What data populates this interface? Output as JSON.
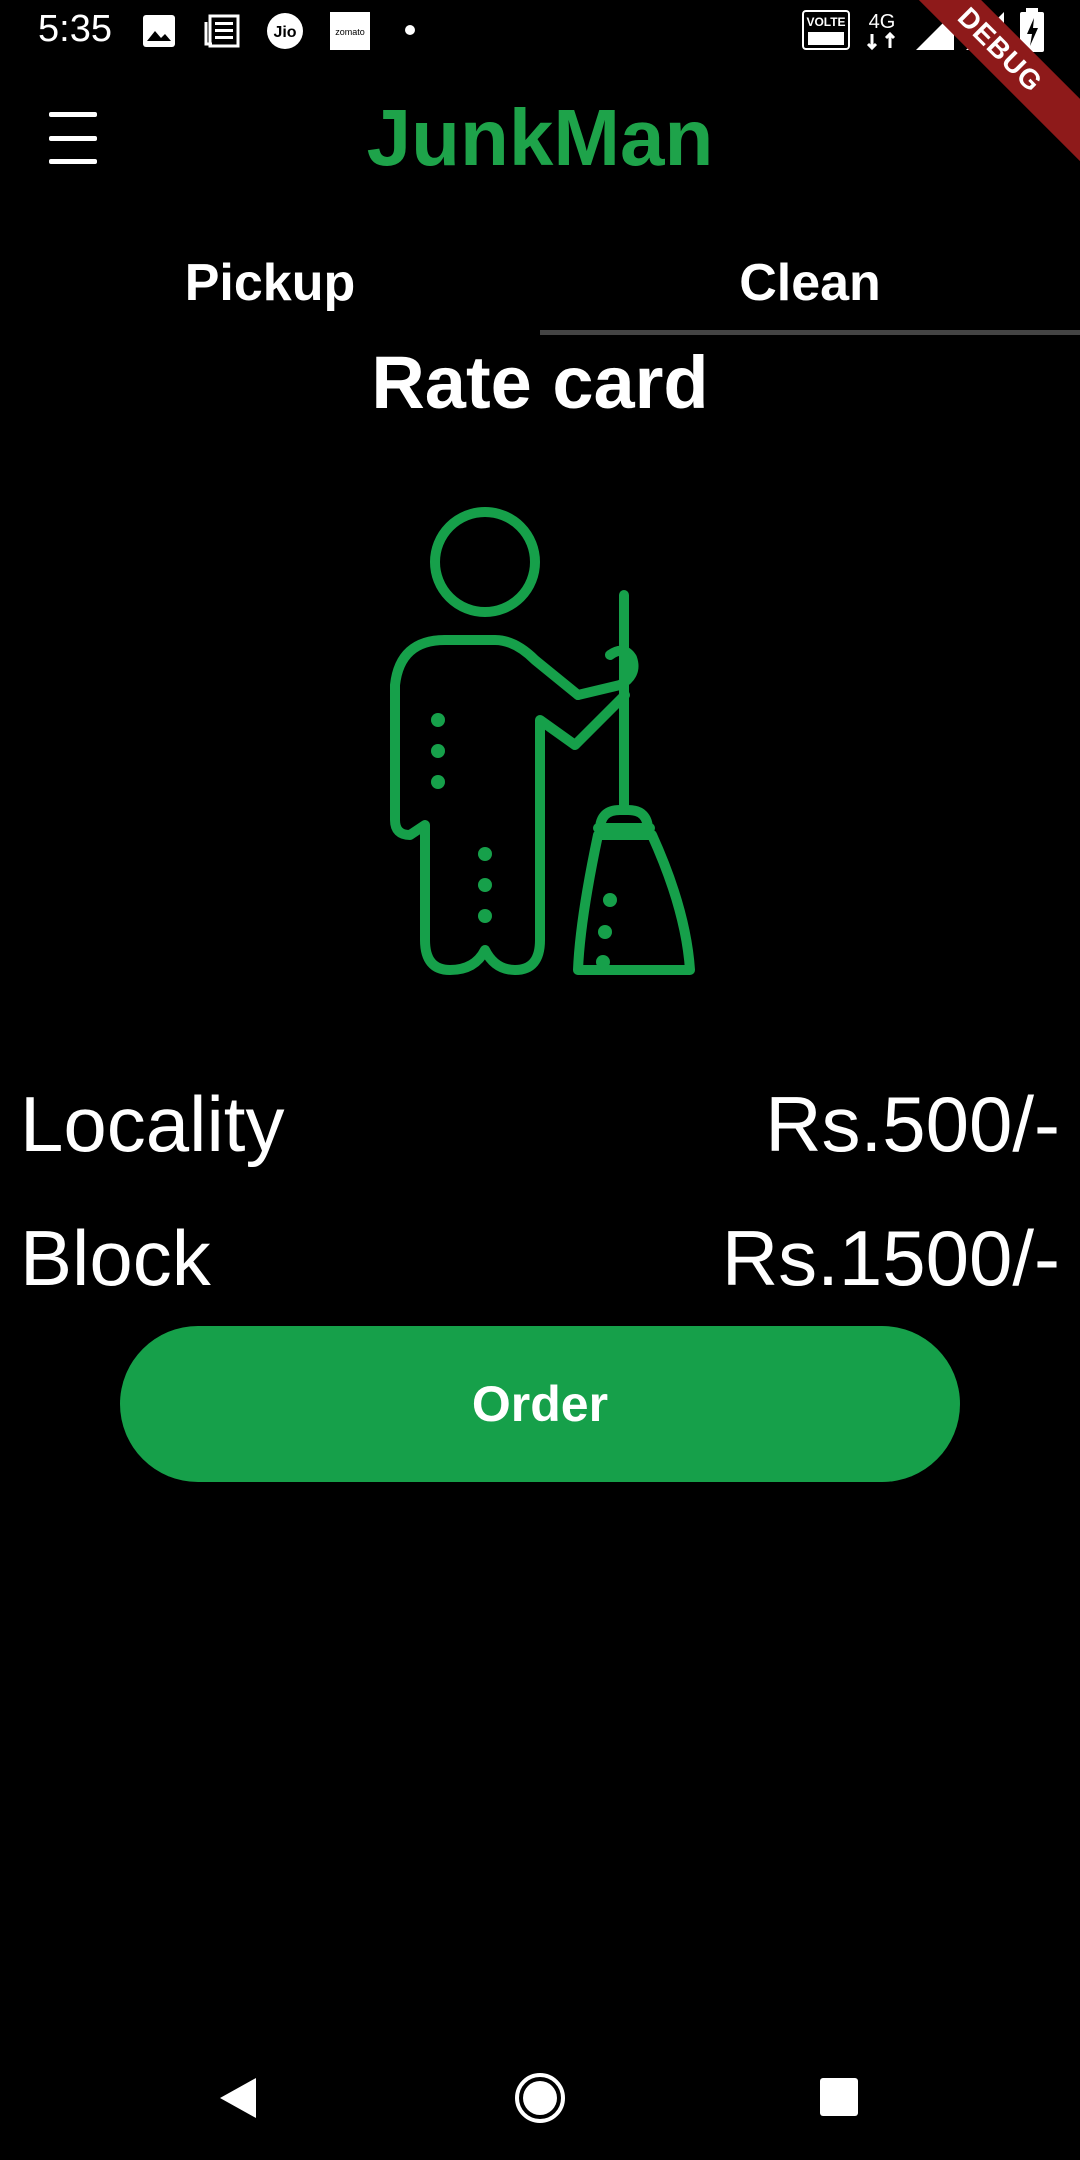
{
  "status_bar": {
    "time": "5:35",
    "left_icons": [
      "gallery-icon",
      "news-icon",
      "jio-icon",
      "zomato-icon",
      "dot-icon"
    ],
    "jio_label": "Jio",
    "zomato_label": "zomato",
    "right_icons": [
      "volte-icon",
      "4g-icon",
      "signal-icon",
      "signal-icon",
      "battery-charging-icon"
    ],
    "volte_label": "VOLTE",
    "network_label": "4G",
    "debug_label": "DEBUG"
  },
  "app_bar": {
    "title": "JunkMan",
    "title_color": "#1ea34a",
    "menu_icon": "hamburger-menu-icon"
  },
  "tabs": [
    {
      "label": "Pickup",
      "selected": false
    },
    {
      "label": "Clean",
      "selected": true
    }
  ],
  "rate_card": {
    "title": "Rate card",
    "illustration_icon": "cleaner-with-broom-icon",
    "rows": [
      {
        "label": "Locality",
        "price": "Rs.500/-"
      },
      {
        "label": "Block",
        "price": "Rs.1500/-"
      }
    ]
  },
  "order_button": {
    "label": "Order",
    "color": "#16a04a"
  },
  "nav_bar": {
    "icons": [
      "back-icon",
      "home-icon",
      "recents-icon"
    ]
  }
}
